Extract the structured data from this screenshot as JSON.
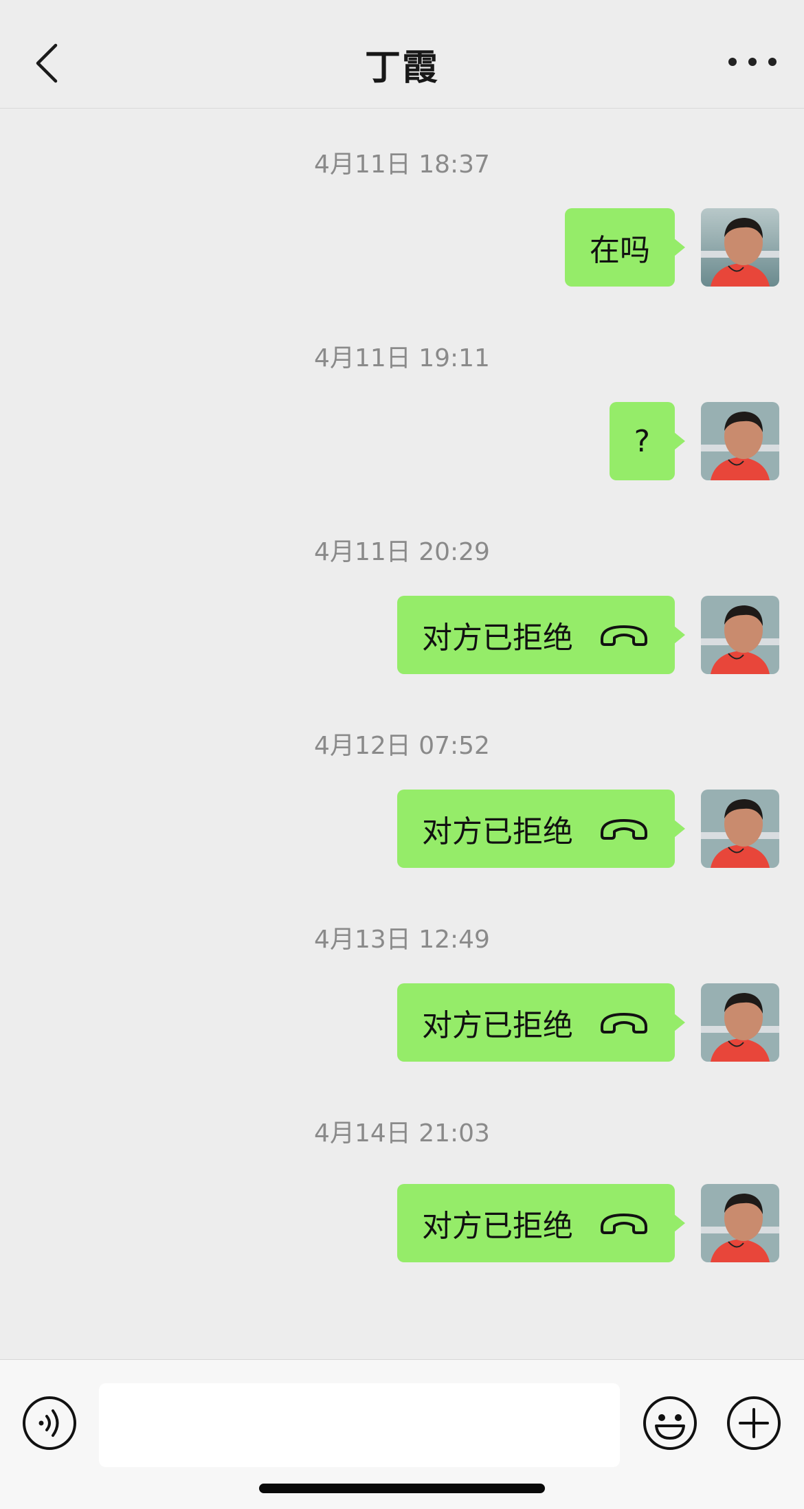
{
  "header": {
    "title": "丁霞"
  },
  "messages": [
    {
      "time": "4月11日 18:37",
      "text": "在吗",
      "type": "text"
    },
    {
      "time": "4月11日 19:11",
      "text": "?",
      "type": "text"
    },
    {
      "time": "4月11日 20:29",
      "text": "对方已拒绝",
      "type": "call"
    },
    {
      "time": "4月12日 07:52",
      "text": "对方已拒绝",
      "type": "call"
    },
    {
      "time": "4月13日 12:49",
      "text": "对方已拒绝",
      "type": "call"
    },
    {
      "time": "4月14日 21:03",
      "text": "对方已拒绝",
      "type": "call"
    }
  ],
  "input": {
    "value": "",
    "placeholder": ""
  },
  "colors": {
    "bubble": "#95ec69",
    "background": "#ededed",
    "timestamp": "#8a8a8a"
  },
  "icons": {
    "back": "chevron-left-icon",
    "more": "more-dots-icon",
    "call": "phone-hangup-icon",
    "voice": "voice-icon",
    "emoji": "emoji-icon",
    "plus": "plus-icon",
    "avatar": "avatar"
  }
}
